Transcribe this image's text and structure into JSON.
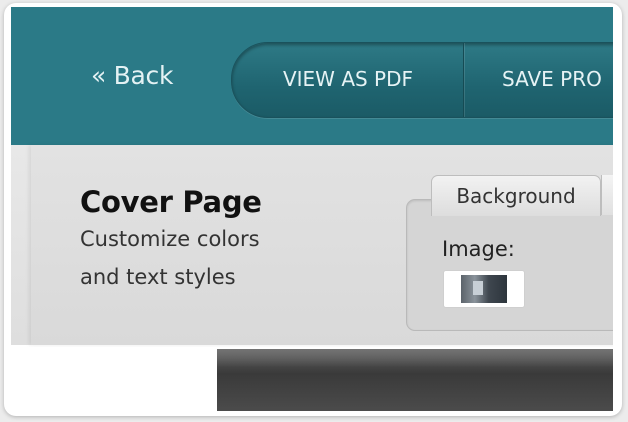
{
  "header": {
    "back_label": "« Back",
    "nav": {
      "view_pdf_label": "VIEW AS PDF",
      "save_label": "SAVE PRO"
    }
  },
  "panel": {
    "title": "Cover Page",
    "subtitle_line1": "Customize colors",
    "subtitle_line2": "and text styles",
    "settings": {
      "tab_label": "Background",
      "image_label": "Image:"
    }
  },
  "colors": {
    "header_bg": "#2b7a87",
    "panel_bg": "#dedede",
    "nav_bg": "#1f6470"
  }
}
